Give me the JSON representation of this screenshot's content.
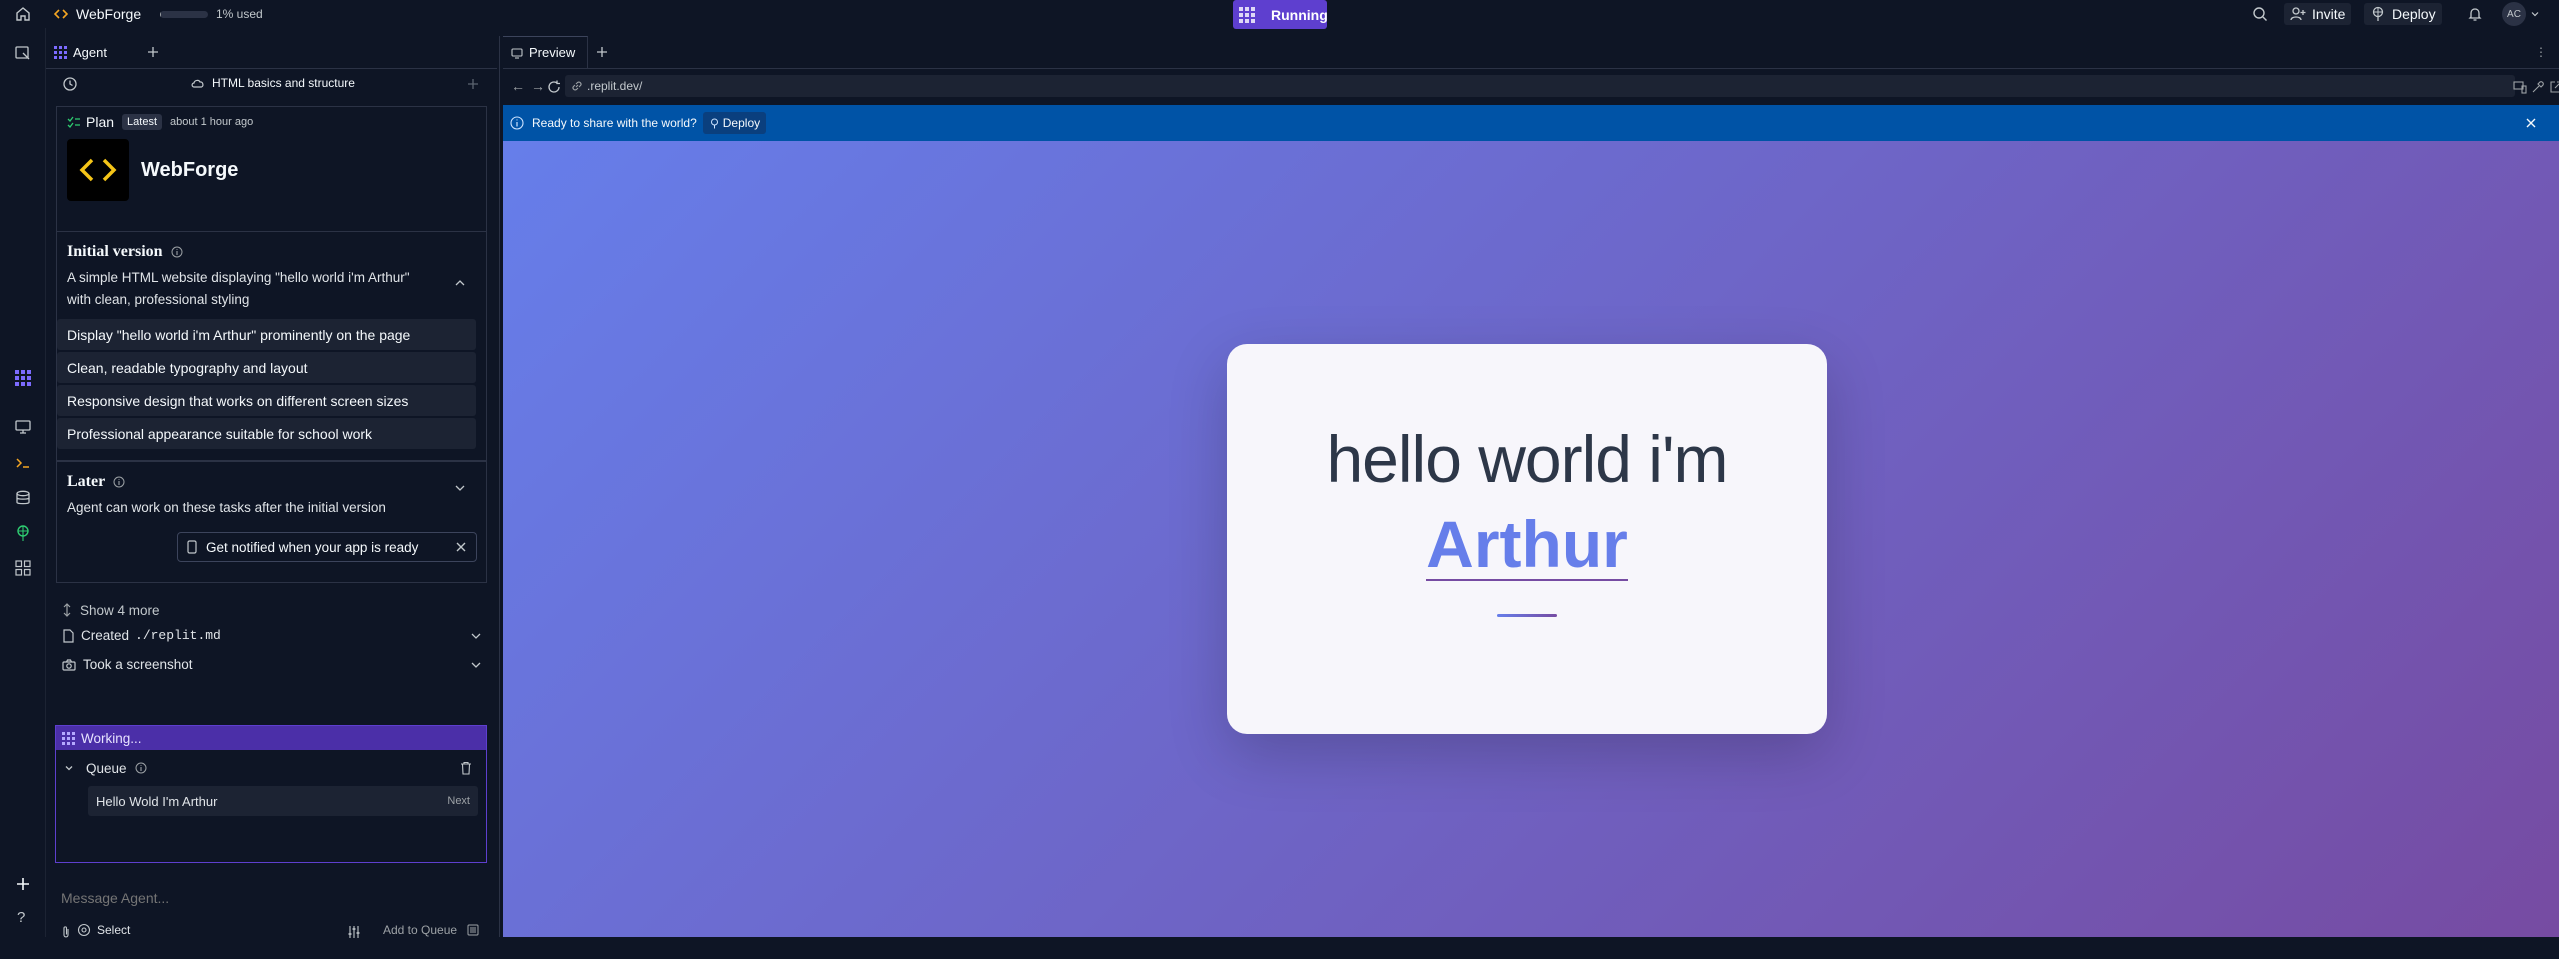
{
  "topbar": {
    "app_name": "WebForge",
    "usage": "1% used",
    "usage_fraction": 0.01,
    "run_status": "Running",
    "invite_label": "Invite",
    "deploy_label": "Deploy",
    "avatar_initials": "AC"
  },
  "agent": {
    "tab_label": "Agent",
    "thread_title": "HTML basics and structure",
    "plan": {
      "label": "Plan",
      "badge": "Latest",
      "time": "about 1 hour ago",
      "app_name": "WebForge",
      "initial": {
        "title": "Initial version",
        "description": "A simple HTML website displaying \"hello world i'm Arthur\" with clean, professional styling",
        "items": [
          "Display \"hello world i'm Arthur\" prominently on the page",
          "Clean, readable typography and layout",
          "Responsive design that works on different screen sizes",
          "Professional appearance suitable for school work"
        ]
      },
      "later": {
        "title": "Later",
        "description": "Agent can work on these tasks after the initial version"
      },
      "notify_label": "Get notified when your app is ready"
    },
    "show_more": "Show 4 more",
    "created_prefix": "Created",
    "created_file": "./replit.md",
    "screenshot_label": "Took a screenshot",
    "working_label": "Working...",
    "queue_label": "Queue",
    "queue_item": "Hello Wold I'm Arthur",
    "queue_item_next": "Next",
    "message_placeholder": "Message Agent...",
    "select_label": "Select",
    "add_to_queue": "Add to Queue"
  },
  "preview": {
    "tab_label": "Preview",
    "url": ".replit.dev/",
    "banner_text": "Ready to share with the world?",
    "banner_deploy": "Deploy",
    "page": {
      "greeting": "hello world i'm",
      "name": "Arthur"
    }
  },
  "colors": {
    "accent": "#5e3fcf",
    "banner": "#0053a6",
    "gradient_start": "#667eea",
    "gradient_end": "#764ba2"
  }
}
